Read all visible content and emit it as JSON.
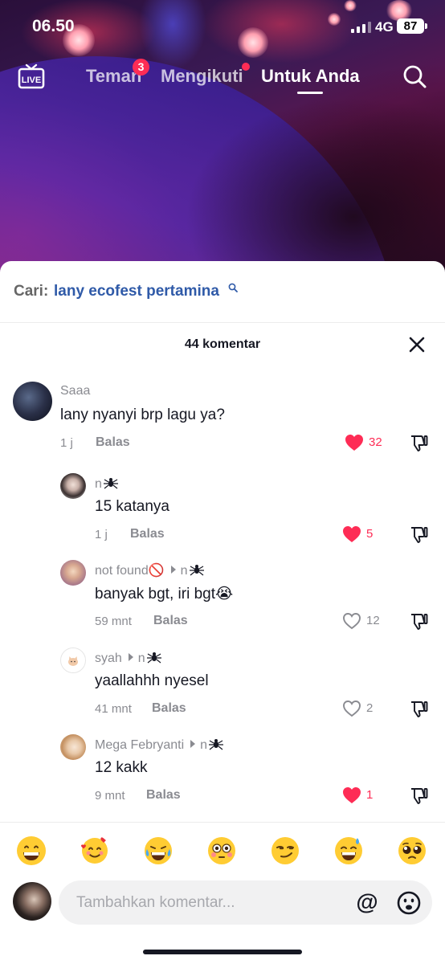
{
  "status_bar": {
    "time": "06.50",
    "network": "4G",
    "battery": "87"
  },
  "top_nav": {
    "tabs": [
      {
        "label": "Teman",
        "badge": "3"
      },
      {
        "label": "Mengikuti"
      },
      {
        "label": "Untuk Anda"
      }
    ]
  },
  "search": {
    "prefix": "Cari:",
    "query": "lany ecofest pertamina"
  },
  "comments_header": {
    "count_label": "44 komentar"
  },
  "comments": [
    {
      "user": "Saaa",
      "reply_to": "",
      "text": "lany nyanyi brp lagu ya?",
      "time": "1 j",
      "reply_label": "Balas",
      "likes": "32",
      "liked": true
    },
    {
      "user": "n",
      "reply_to": "",
      "text": "15 katanya",
      "time": "1 j",
      "reply_label": "Balas",
      "likes": "5",
      "liked": true
    },
    {
      "user": "not found🚫",
      "reply_to": "n",
      "text": "banyak bgt, iri bgt😭",
      "time": "59 mnt",
      "reply_label": "Balas",
      "likes": "12",
      "liked": false
    },
    {
      "user": "syah",
      "reply_to": "n",
      "text": "yaallahhh nyesel",
      "time": "41 mnt",
      "reply_label": "Balas",
      "likes": "2",
      "liked": false
    },
    {
      "user": "Mega Febryanti",
      "reply_to": "n",
      "text": "12 kakk",
      "time": "9 mnt",
      "reply_label": "Balas",
      "likes": "1",
      "liked": true
    }
  ],
  "emoji_bar": [
    "😁",
    "🥰",
    "😂",
    "😳",
    "😏",
    "😅",
    "🥺"
  ],
  "input": {
    "placeholder": "Tambahkan komentar...",
    "mention": "@"
  },
  "colors": {
    "accent": "#fe2c55",
    "link": "#2f5aa8",
    "muted": "#8a8b91",
    "text": "#161823"
  },
  "icons": {
    "live": "live-tv-icon",
    "search": "search-icon",
    "close": "close-icon",
    "like": "heart-icon",
    "dislike": "thumbs-down-icon",
    "mention": "at-icon",
    "emoji": "smile-icon"
  }
}
